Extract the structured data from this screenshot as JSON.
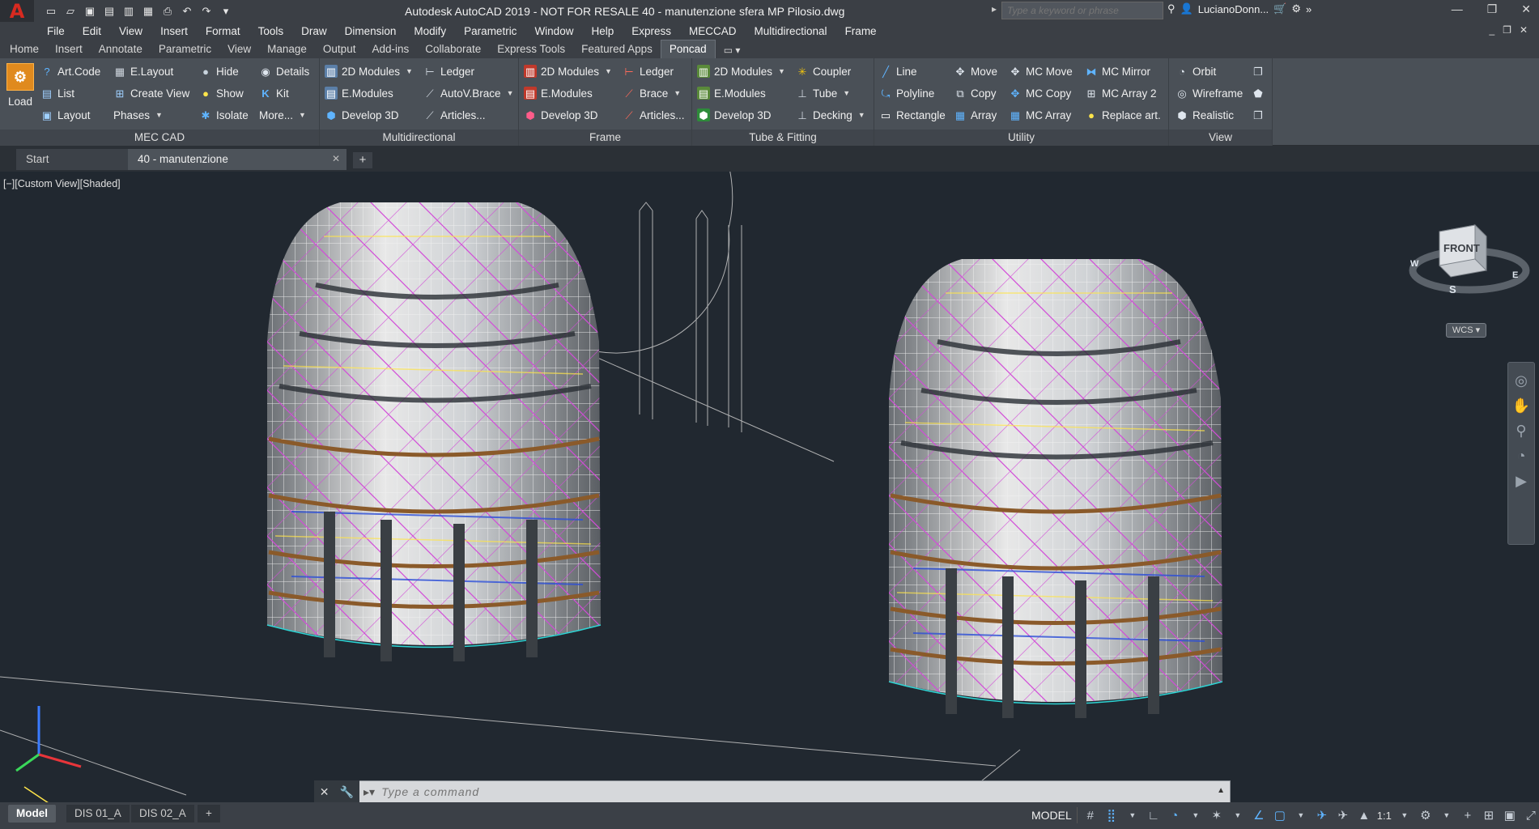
{
  "title": {
    "text": "Autodesk AutoCAD 2019 - NOT FOR RESALE    40 - manutenzione sfera MP  Pilosio.dwg",
    "app_logo": "A",
    "search_placeholder": "Type a keyword or phrase",
    "user": "LucianoDonn..."
  },
  "menu": [
    "File",
    "Edit",
    "View",
    "Insert",
    "Format",
    "Tools",
    "Draw",
    "Dimension",
    "Modify",
    "Parametric",
    "Window",
    "Help",
    "Express",
    "MECCAD",
    "Multidirectional",
    "Frame"
  ],
  "ribbon_tabs": [
    "Home",
    "Insert",
    "Annotate",
    "Parametric",
    "View",
    "Manage",
    "Output",
    "Add-ins",
    "Collaborate",
    "Express Tools",
    "Featured Apps",
    "Poncad"
  ],
  "ribbon": {
    "mec_cad": {
      "title": "MEC CAD",
      "load": "Load",
      "art_code": "Art.Code",
      "list": "List",
      "layout": "Layout",
      "e_layout": "E.Layout",
      "create_view": "Create View",
      "phases": "Phases",
      "hide": "Hide",
      "show": "Show",
      "isolate": "Isolate",
      "details": "Details",
      "kit": "Kit",
      "more": "More..."
    },
    "multidirectional": {
      "title": "Multidirectional",
      "modules_2d": "2D Modules",
      "e_modules": "E.Modules",
      "develop_3d": "Develop 3D",
      "ledger": "Ledger",
      "autov_brace": "AutoV.Brace",
      "articles": "Articles..."
    },
    "frame": {
      "title": "Frame",
      "modules_2d": "2D Modules",
      "e_modules": "E.Modules",
      "develop_3d": "Develop 3D",
      "ledger": "Ledger",
      "brace": "Brace",
      "articles": "Articles..."
    },
    "tube_fitting": {
      "title": "Tube & Fitting",
      "modules_2d": "2D Modules",
      "e_modules": "E.Modules",
      "develop_3d": "Develop 3D",
      "coupler": "Coupler",
      "tube": "Tube",
      "decking": "Decking"
    },
    "utility": {
      "title": "Utility",
      "line": "Line",
      "polyline": "Polyline",
      "rectangle": "Rectangle",
      "move": "Move",
      "copy": "Copy",
      "array": "Array",
      "mc_move": "MC Move",
      "mc_copy": "MC Copy",
      "mc_array": "MC Array",
      "mc_mirror": "MC Mirror",
      "mc_array_2": "MC Array 2",
      "replace_art": "Replace art."
    },
    "view": {
      "title": "View",
      "orbit": "Orbit",
      "wireframe": "Wireframe",
      "realistic": "Realistic"
    }
  },
  "doc_tabs": {
    "start": "Start",
    "current": "40 - manutenzione"
  },
  "viewport": {
    "label": "[−][Custom View][Shaded]",
    "viewcube_face": "FRONT",
    "compass": {
      "w": "W",
      "s": "S",
      "e": "E"
    },
    "wcs": "WCS"
  },
  "command_line": {
    "placeholder": "Type a command"
  },
  "layout_tabs": {
    "model": "Model",
    "layout1": "DIS 01_A",
    "layout2": "DIS 02_A",
    "add": "+"
  },
  "status": {
    "model": "MODEL",
    "scale": "1:1"
  },
  "colors": {
    "viewport_bg": "#212830",
    "ribbon_bg": "#4a5057",
    "accent": "#e08a1e",
    "scaffold_magenta": "#d24bd8",
    "scaffold_white": "#e8e8e8"
  }
}
